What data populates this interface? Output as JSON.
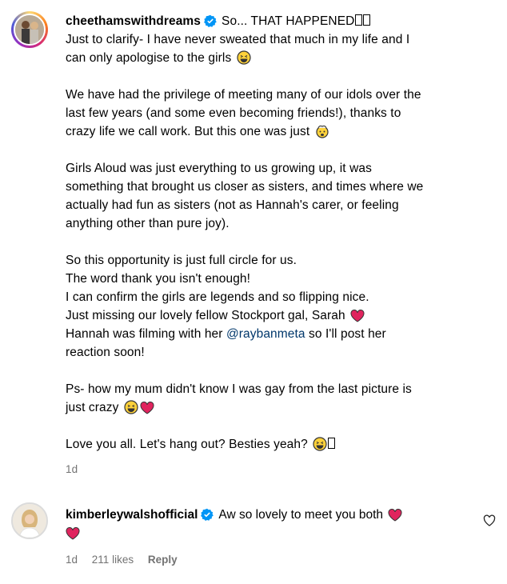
{
  "post": {
    "username": "cheethamswithdreams",
    "headline": "So... THAT HAPPENED",
    "line_clarify_1": "Just to clarify- I have never sweated that much in my life and I",
    "line_clarify_2": "can only apologise to the girls",
    "para1_1": "We have had the privilege of meeting many of our idols over the",
    "para1_2": "last few years (and some even becoming friends!), thanks to",
    "para1_3": "crazy life we call work. But this one was just",
    "para2_1": "Girls Aloud was just everything to us growing up, it was",
    "para2_2": "something that brought us closer as sisters, and times where we",
    "para2_3": "actually had fun as sisters (not as Hannah's carer, or feeling",
    "para2_4": "anything other than pure joy).",
    "para3_1": "So this opportunity is just full circle for us.",
    "para3_2": "The word thank you isn't enough!",
    "para3_3": "I can confirm the girls are legends and so flipping nice.",
    "para3_4": "Just missing our lovely fellow Stockport gal, Sarah",
    "para3_5_pre": "Hannah was filming with her ",
    "mention": "@raybanmeta",
    "para3_5_post": " so I'll post her",
    "para3_6": "reaction soon!",
    "ps_1": "Ps- how my mum didn't know I was gay from the last picture is",
    "ps_2": "just crazy",
    "closing": "Love you all. Let's hang out? Besties yeah?",
    "time": "1d"
  },
  "comment": {
    "username": "kimberleywalshofficial",
    "text": "Aw so lovely to meet you both",
    "time": "1d",
    "likes": "211 likes",
    "reply": "Reply"
  },
  "icons": {
    "verified": "verified-badge-icon",
    "like": "heart-outline-icon"
  },
  "colors": {
    "verified": "#0095f6",
    "mention": "#00376b",
    "meta": "#737373",
    "heart": "#e0245e"
  }
}
